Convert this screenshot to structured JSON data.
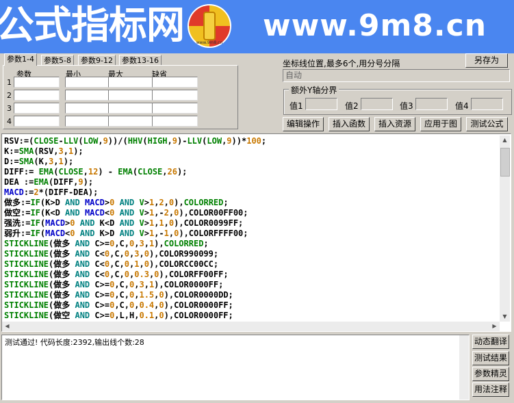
{
  "banner": {
    "left_text": "公式指标网",
    "right_text": "www.9m8.cn",
    "logo_text": "www.9m8.cn"
  },
  "tabs": [
    {
      "label": "参数1-4",
      "active": true
    },
    {
      "label": "参数5-8",
      "active": false
    },
    {
      "label": "参数9-12",
      "active": false
    },
    {
      "label": "参数13-16",
      "active": false
    }
  ],
  "param_table": {
    "headers": [
      "参数",
      "最小",
      "最大",
      "缺省"
    ],
    "rows": [
      "1",
      "2",
      "3",
      "4"
    ]
  },
  "axis": {
    "label": "坐标线位置,最多6个,用分号分隔",
    "value": "自动"
  },
  "save_as_label": "另存为",
  "extra_y": {
    "title": "额外Y轴分界",
    "labels": [
      "值1",
      "值2",
      "值3",
      "值4"
    ]
  },
  "toolbar": [
    "编辑操作",
    "插入函数",
    "插入资源",
    "应用于图",
    "测试公式"
  ],
  "code_lines": [
    [
      [
        "k",
        "RSV:=("
      ],
      [
        "g",
        "CLOSE"
      ],
      [
        "k",
        "-"
      ],
      [
        "g",
        "LLV"
      ],
      [
        "k",
        "("
      ],
      [
        "g",
        "LOW"
      ],
      [
        "k",
        ","
      ],
      [
        "o",
        "9"
      ],
      [
        "k",
        "))/("
      ],
      [
        "g",
        "HHV"
      ],
      [
        "k",
        "("
      ],
      [
        "g",
        "HIGH"
      ],
      [
        "k",
        ","
      ],
      [
        "o",
        "9"
      ],
      [
        "k",
        ")-"
      ],
      [
        "g",
        "LLV"
      ],
      [
        "k",
        "("
      ],
      [
        "g",
        "LOW"
      ],
      [
        "k",
        ","
      ],
      [
        "o",
        "9"
      ],
      [
        "k",
        "))*"
      ],
      [
        "o",
        "100"
      ],
      [
        "k",
        ";"
      ]
    ],
    [
      [
        "k",
        "K:="
      ],
      [
        "g",
        "SMA"
      ],
      [
        "k",
        "(RSV,"
      ],
      [
        "o",
        "3"
      ],
      [
        "k",
        ","
      ],
      [
        "o",
        "1"
      ],
      [
        "k",
        ");"
      ]
    ],
    [
      [
        "k",
        "D:="
      ],
      [
        "g",
        "SMA"
      ],
      [
        "k",
        "(K,"
      ],
      [
        "o",
        "3"
      ],
      [
        "k",
        ","
      ],
      [
        "o",
        "1"
      ],
      [
        "k",
        ");"
      ]
    ],
    [
      [
        "k",
        "DIFF:= "
      ],
      [
        "g",
        "EMA"
      ],
      [
        "k",
        "("
      ],
      [
        "g",
        "CLOSE"
      ],
      [
        "k",
        ","
      ],
      [
        "o",
        "12"
      ],
      [
        "k",
        ") - "
      ],
      [
        "g",
        "EMA"
      ],
      [
        "k",
        "("
      ],
      [
        "g",
        "CLOSE"
      ],
      [
        "k",
        ","
      ],
      [
        "o",
        "26"
      ],
      [
        "k",
        ");"
      ]
    ],
    [
      [
        "k",
        "DEA :="
      ],
      [
        "g",
        "EMA"
      ],
      [
        "k",
        "(DIFF,"
      ],
      [
        "o",
        "9"
      ],
      [
        "k",
        ");"
      ]
    ],
    [
      [
        "b",
        "MACD"
      ],
      [
        "k",
        ":="
      ],
      [
        "o",
        "2"
      ],
      [
        "k",
        "*(DIFF-DEA);"
      ]
    ],
    [
      [
        "k",
        "做多:="
      ],
      [
        "g",
        "IF"
      ],
      [
        "k",
        "(K>D "
      ],
      [
        "t",
        "AND"
      ],
      [
        "k",
        " "
      ],
      [
        "b",
        "MACD"
      ],
      [
        "k",
        ">"
      ],
      [
        "o",
        "0"
      ],
      [
        "k",
        " "
      ],
      [
        "t",
        "AND"
      ],
      [
        "k",
        " "
      ],
      [
        "g",
        "V"
      ],
      [
        "k",
        ">"
      ],
      [
        "o",
        "1"
      ],
      [
        "k",
        ","
      ],
      [
        "o",
        "2"
      ],
      [
        "k",
        ","
      ],
      [
        "o",
        "0"
      ],
      [
        "k",
        "),"
      ],
      [
        "g",
        "COLORRED"
      ],
      [
        "k",
        ";"
      ]
    ],
    [
      [
        "k",
        "做空:="
      ],
      [
        "g",
        "IF"
      ],
      [
        "k",
        "(K<D "
      ],
      [
        "t",
        "AND"
      ],
      [
        "k",
        " "
      ],
      [
        "b",
        "MACD"
      ],
      [
        "k",
        "<"
      ],
      [
        "o",
        "0"
      ],
      [
        "k",
        " "
      ],
      [
        "t",
        "AND"
      ],
      [
        "k",
        " "
      ],
      [
        "g",
        "V"
      ],
      [
        "k",
        ">"
      ],
      [
        "o",
        "1"
      ],
      [
        "k",
        ",-"
      ],
      [
        "o",
        "2"
      ],
      [
        "k",
        ","
      ],
      [
        "o",
        "0"
      ],
      [
        "k",
        "),COLOR00FF00;"
      ]
    ],
    [
      [
        "k",
        "强洗:="
      ],
      [
        "g",
        "IF"
      ],
      [
        "k",
        "("
      ],
      [
        "b",
        "MACD"
      ],
      [
        "k",
        ">"
      ],
      [
        "o",
        "0"
      ],
      [
        "k",
        " "
      ],
      [
        "t",
        "AND"
      ],
      [
        "k",
        " K<D "
      ],
      [
        "t",
        "AND"
      ],
      [
        "k",
        " "
      ],
      [
        "g",
        "V"
      ],
      [
        "k",
        ">"
      ],
      [
        "o",
        "1"
      ],
      [
        "k",
        ","
      ],
      [
        "o",
        "1"
      ],
      [
        "k",
        ","
      ],
      [
        "o",
        "0"
      ],
      [
        "k",
        "),COLOR0099FF;"
      ]
    ],
    [
      [
        "k",
        "弱升:="
      ],
      [
        "g",
        "IF"
      ],
      [
        "k",
        "("
      ],
      [
        "b",
        "MACD"
      ],
      [
        "k",
        "<"
      ],
      [
        "o",
        "0"
      ],
      [
        "k",
        " "
      ],
      [
        "t",
        "AND"
      ],
      [
        "k",
        " K>D "
      ],
      [
        "t",
        "AND"
      ],
      [
        "k",
        " "
      ],
      [
        "g",
        "V"
      ],
      [
        "k",
        ">"
      ],
      [
        "o",
        "1"
      ],
      [
        "k",
        ",-"
      ],
      [
        "o",
        "1"
      ],
      [
        "k",
        ","
      ],
      [
        "o",
        "0"
      ],
      [
        "k",
        "),COLORFFFF00;"
      ]
    ],
    [
      [
        "g",
        "STICKLINE"
      ],
      [
        "k",
        "(做多 "
      ],
      [
        "t",
        "AND"
      ],
      [
        "k",
        " C>="
      ],
      [
        "o",
        "0"
      ],
      [
        "k",
        ",C,"
      ],
      [
        "o",
        "0"
      ],
      [
        "k",
        ","
      ],
      [
        "o",
        "3"
      ],
      [
        "k",
        ","
      ],
      [
        "o",
        "1"
      ],
      [
        "k",
        "),"
      ],
      [
        "g",
        "COLORRED"
      ],
      [
        "k",
        ";"
      ]
    ],
    [
      [
        "g",
        "STICKLINE"
      ],
      [
        "k",
        "(做多 "
      ],
      [
        "t",
        "AND"
      ],
      [
        "k",
        " C<"
      ],
      [
        "o",
        "0"
      ],
      [
        "k",
        ",C,"
      ],
      [
        "o",
        "0"
      ],
      [
        "k",
        ","
      ],
      [
        "o",
        "3"
      ],
      [
        "k",
        ","
      ],
      [
        "o",
        "0"
      ],
      [
        "k",
        "),COLOR990099;"
      ]
    ],
    [
      [
        "g",
        "STICKLINE"
      ],
      [
        "k",
        "(做多 "
      ],
      [
        "t",
        "AND"
      ],
      [
        "k",
        " C<"
      ],
      [
        "o",
        "0"
      ],
      [
        "k",
        ",C,"
      ],
      [
        "o",
        "0"
      ],
      [
        "k",
        ","
      ],
      [
        "o",
        "1"
      ],
      [
        "k",
        ","
      ],
      [
        "o",
        "0"
      ],
      [
        "k",
        "),COLORCC00CC;"
      ]
    ],
    [
      [
        "g",
        "STICKLINE"
      ],
      [
        "k",
        "(做多 "
      ],
      [
        "t",
        "AND"
      ],
      [
        "k",
        " C<"
      ],
      [
        "o",
        "0"
      ],
      [
        "k",
        ",C,"
      ],
      [
        "o",
        "0"
      ],
      [
        "k",
        ","
      ],
      [
        "o",
        "0.3"
      ],
      [
        "k",
        ","
      ],
      [
        "o",
        "0"
      ],
      [
        "k",
        "),COLORFF00FF;"
      ]
    ],
    [
      [
        "g",
        "STICKLINE"
      ],
      [
        "k",
        "(做多 "
      ],
      [
        "t",
        "AND"
      ],
      [
        "k",
        " C>="
      ],
      [
        "o",
        "0"
      ],
      [
        "k",
        ",C,"
      ],
      [
        "o",
        "0"
      ],
      [
        "k",
        ","
      ],
      [
        "o",
        "3"
      ],
      [
        "k",
        ","
      ],
      [
        "o",
        "1"
      ],
      [
        "k",
        "),COLOR0000FF;"
      ]
    ],
    [
      [
        "g",
        "STICKLINE"
      ],
      [
        "k",
        "(做多 "
      ],
      [
        "t",
        "AND"
      ],
      [
        "k",
        " C>="
      ],
      [
        "o",
        "0"
      ],
      [
        "k",
        ",C,"
      ],
      [
        "o",
        "0"
      ],
      [
        "k",
        ","
      ],
      [
        "o",
        "1.5"
      ],
      [
        "k",
        ","
      ],
      [
        "o",
        "0"
      ],
      [
        "k",
        "),COLOR0000DD;"
      ]
    ],
    [
      [
        "g",
        "STICKLINE"
      ],
      [
        "k",
        "(做多 "
      ],
      [
        "t",
        "AND"
      ],
      [
        "k",
        " C>="
      ],
      [
        "o",
        "0"
      ],
      [
        "k",
        ",C,"
      ],
      [
        "o",
        "0"
      ],
      [
        "k",
        ","
      ],
      [
        "o",
        "0.4"
      ],
      [
        "k",
        ","
      ],
      [
        "o",
        "0"
      ],
      [
        "k",
        "),COLOR0000FF;"
      ]
    ],
    [
      [
        "g",
        "STICKLINE"
      ],
      [
        "k",
        "(做空 "
      ],
      [
        "t",
        "AND"
      ],
      [
        "k",
        " C>="
      ],
      [
        "o",
        "0"
      ],
      [
        "k",
        ",L,H,"
      ],
      [
        "o",
        "0.1"
      ],
      [
        "k",
        ","
      ],
      [
        "o",
        "0"
      ],
      [
        "k",
        "),COLOR0000FF;"
      ]
    ]
  ],
  "status_text": "测试通过! 代码长度:2392,输出线个数:28",
  "side_buttons": [
    "动态翻译",
    "测试结果",
    "参数精灵",
    "用法注释"
  ],
  "colors": {
    "banner": "#4a86f0",
    "window": "#d4d0c8",
    "code_keyword": "#000000",
    "code_function": "#008000",
    "code_macd": "#0000c8",
    "code_and": "#008080",
    "code_number": "#c87800"
  }
}
